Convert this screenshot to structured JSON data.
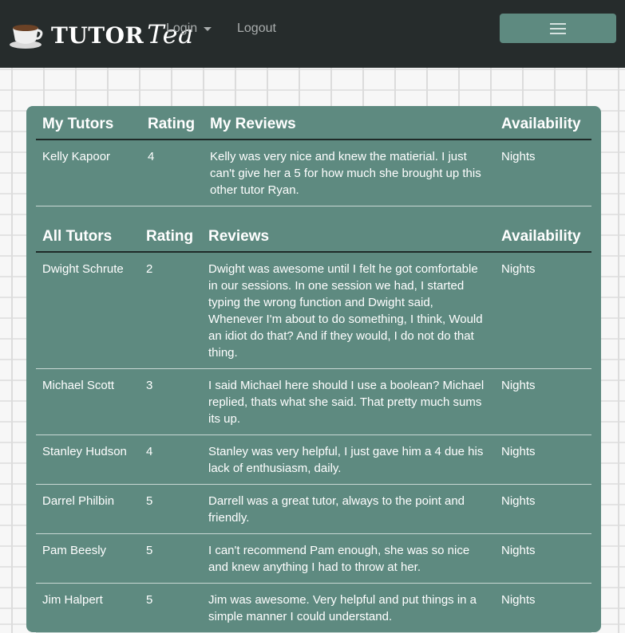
{
  "navbar": {
    "brand": {
      "word1": "Tutor",
      "word2": "Tea",
      "logo_icon": "teacup-icon"
    },
    "login_label": "Login",
    "logout_label": "Logout",
    "menu_icon": "hamburger-icon"
  },
  "colors": {
    "navbar_bg": "#262c2c",
    "card_bg": "#5e8a80",
    "toggler_bg": "#5e8a80"
  },
  "my_tutors": {
    "headers": [
      "My Tutors",
      "Rating",
      "My Reviews",
      "Availability"
    ],
    "rows": [
      {
        "name": "Kelly Kapoor",
        "rating": "4",
        "review": "Kelly was very nice and knew the matierial. I just can't give her a 5 for how much she brought up this other tutor Ryan.",
        "availability": "Nights"
      }
    ]
  },
  "all_tutors": {
    "headers": [
      "All Tutors",
      "Rating",
      "Reviews",
      "Availability"
    ],
    "rows": [
      {
        "name": "Dwight Schrute",
        "rating": "2",
        "review": "Dwight was awesome until I felt he got comfortable in our sessions. In one session we had, I started typing the wrong function and Dwight said, Whenever I'm about to do something, I think, Would an idiot do that? And if they would, I do not do that thing.",
        "availability": "Nights"
      },
      {
        "name": "Michael Scott",
        "rating": "3",
        "review": "I said Michael here should I use a boolean? Michael replied, thats what she said. That pretty much sums its up.",
        "availability": "Nights"
      },
      {
        "name": "Stanley Hudson",
        "rating": "4",
        "review": "Stanley was very helpful, I just gave him a 4 due his lack of enthusiasm, daily.",
        "availability": "Nights"
      },
      {
        "name": "Darrel Philbin",
        "rating": "5",
        "review": "Darrell was a great tutor, always to the point and friendly.",
        "availability": "Nights"
      },
      {
        "name": "Pam Beesly",
        "rating": "5",
        "review": "I can't recommend Pam enough, she was so nice and knew anything I had to throw at her.",
        "availability": "Nights"
      },
      {
        "name": "Jim Halpert",
        "rating": "5",
        "review": "Jim was awesome. Very helpful and put things in a simple manner I could understand.",
        "availability": "Nights"
      }
    ]
  }
}
